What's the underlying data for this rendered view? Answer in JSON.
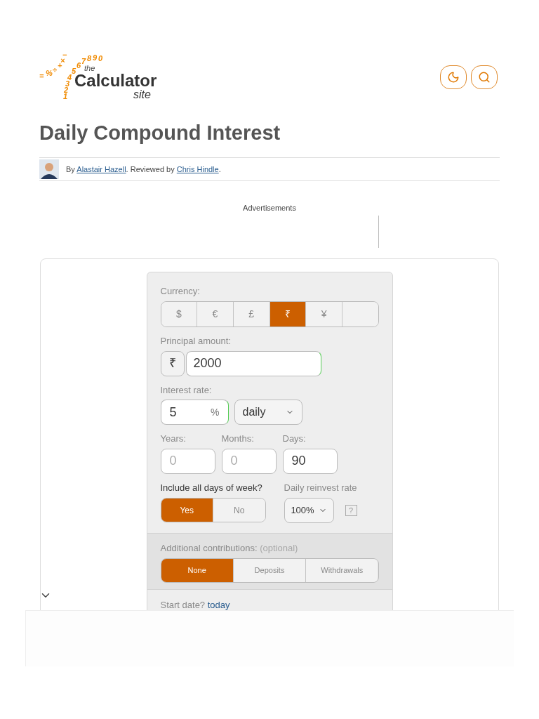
{
  "logo": {
    "digits": "1234567890",
    "symbols": "=%÷+×−",
    "the": "the",
    "name": "Calculator",
    "site": "site"
  },
  "header_buttons": [
    {
      "kind": "theme"
    },
    {
      "kind": "search"
    }
  ],
  "title": "Daily Compound Interest",
  "byline": {
    "prefix": "By ",
    "author": "Alastair Hazell",
    "middle": ". Reviewed by ",
    "reviewer": "Chris Hindle",
    "suffix": "."
  },
  "ads_label": "Advertisements",
  "calculator": {
    "currency": {
      "label": "Currency:",
      "options": [
        {
          "label": "$",
          "selected": false
        },
        {
          "label": "€",
          "selected": false
        },
        {
          "label": "£",
          "selected": false
        },
        {
          "label": "₹",
          "selected": true
        },
        {
          "label": "¥",
          "selected": false
        },
        {
          "selected": false
        }
      ]
    },
    "principal": {
      "label": "Principal amount:",
      "symbol": "₹",
      "value": "2000"
    },
    "interest": {
      "label": "Interest rate:",
      "value": "5",
      "unit": "%",
      "period": "daily"
    },
    "duration": [
      {
        "label": "Years:",
        "placeholder": "0"
      },
      {
        "label": "Months:",
        "placeholder": "0"
      },
      {
        "label": "Days:",
        "value": "90"
      }
    ],
    "all_days": {
      "label": "Include all days of week?",
      "options": [
        {
          "label": "Yes",
          "selected": true
        },
        {
          "label": "No",
          "selected": false
        }
      ]
    },
    "reinvest": {
      "label": "Daily reinvest rate",
      "value": "100%",
      "help": "?"
    },
    "contributions": {
      "label": "Additional contributions:",
      "hint": "(optional)",
      "options": [
        {
          "label": "None",
          "selected": true
        },
        {
          "label": "Deposits",
          "selected": false
        },
        {
          "label": "Withdrawals",
          "selected": false
        }
      ]
    },
    "start_date": {
      "label": "Start date?",
      "link": "today"
    }
  }
}
